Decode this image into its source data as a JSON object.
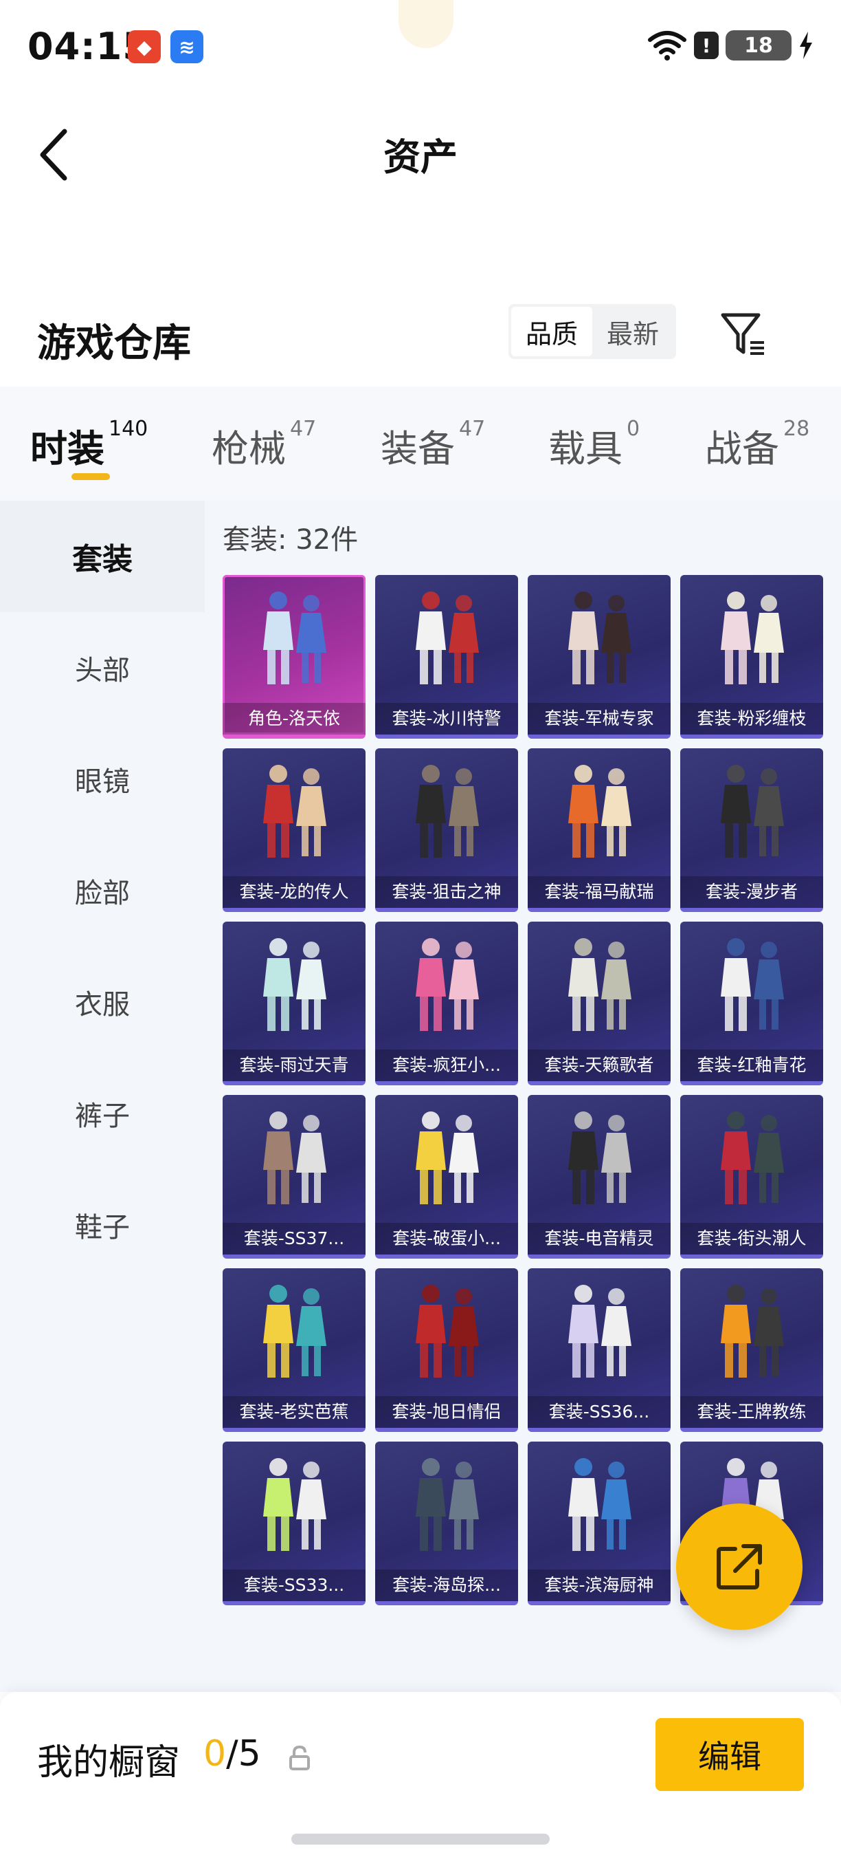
{
  "status": {
    "time": "04:15",
    "battery": "18"
  },
  "header": {
    "title": "资产"
  },
  "warehouse": {
    "title": "游戏仓库",
    "sort_options": [
      "品质",
      "最新"
    ],
    "active_sort": "品质"
  },
  "category_tabs": [
    {
      "label": "时装",
      "count": "140"
    },
    {
      "label": "枪械",
      "count": "47"
    },
    {
      "label": "装备",
      "count": "47"
    },
    {
      "label": "载具",
      "count": "0"
    },
    {
      "label": "战备",
      "count": "28"
    }
  ],
  "sub_nav": [
    "套装",
    "头部",
    "眼镜",
    "脸部",
    "衣服",
    "裤子",
    "鞋子"
  ],
  "content": {
    "label": "套装: 32件"
  },
  "items": [
    "角色-洛天依",
    "套装-冰川特警",
    "套装-军械专家",
    "套装-粉彩缠枝",
    "套装-龙的传人",
    "套装-狙击之神",
    "套装-福马献瑞",
    "套装-漫步者",
    "套装-雨过天青",
    "套装-疯狂小...",
    "套装-天籁歌者",
    "套装-红釉青花",
    "套装-SS37...",
    "套装-破蛋小...",
    "套装-电音精灵",
    "套装-街头潮人",
    "套装-老实芭蕉",
    "套装-旭日情侣",
    "套装-SS36...",
    "套装-王牌教练",
    "套装-SS33...",
    "套装-海岛探...",
    "套装-滨海厨神",
    ""
  ],
  "showcase": {
    "label": "我的橱窗",
    "current": "0",
    "separator": "/",
    "total": "5",
    "edit_label": "编辑"
  },
  "colors": {
    "accent": "#f2b51a",
    "card_bg": "#2c2a6a",
    "card_highlight": "#d04ac0"
  }
}
